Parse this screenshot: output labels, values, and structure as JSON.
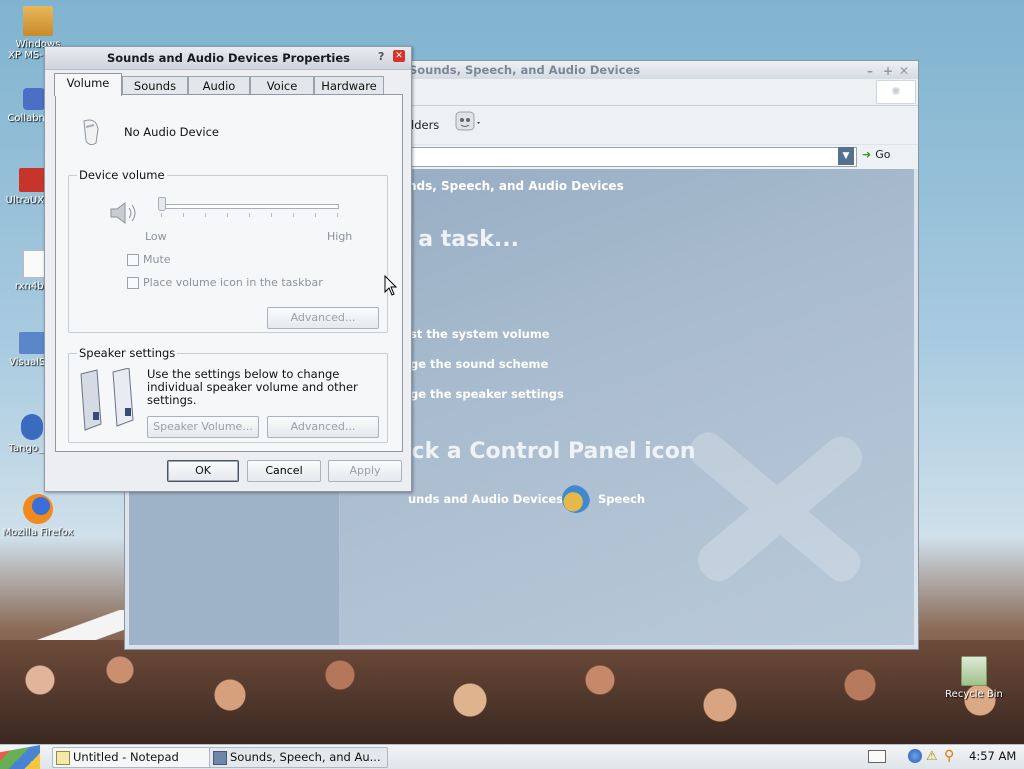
{
  "desktop": {
    "icons": [
      {
        "label": "Windows XP MS-Sig..."
      },
      {
        "label": "Collabne..."
      },
      {
        "label": "UltraUXT..."
      },
      {
        "label": "rxn4b..."
      },
      {
        "label": "VisualS..."
      },
      {
        "label": "Tango_I..."
      },
      {
        "label": "Mozilla Firefox"
      },
      {
        "label": "Recycle Bin"
      }
    ]
  },
  "control_panel": {
    "title": "Sounds, Speech, and Audio Devices",
    "toolbar_folders": "lders",
    "go_label": "Go",
    "crumb": "nds, Speech, and Audio Devices",
    "pick_task": "k a task...",
    "tasks": [
      "st the system volume",
      "ge the sound scheme",
      "ge the speaker settings"
    ],
    "pick_icon": "ick a Control Panel icon",
    "icon1": "unds and Audio Devices",
    "icon2": "Speech"
  },
  "dialog": {
    "title": "Sounds and Audio Devices Properties",
    "help": "?",
    "tabs": [
      "Volume",
      "Sounds",
      "Audio",
      "Voice",
      "Hardware"
    ],
    "device_name": "No Audio Device",
    "device_volume_label": "Device volume",
    "low": "Low",
    "high": "High",
    "mute": "Mute",
    "place_icon": "Place volume icon in the taskbar",
    "advanced1": "Advanced...",
    "speaker_settings_label": "Speaker settings",
    "speaker_text": "Use the settings below to change individual speaker volume and other settings.",
    "speaker_volume_btn": "Speaker Volume...",
    "advanced2": "Advanced...",
    "ok": "OK",
    "cancel": "Cancel",
    "apply": "Apply"
  },
  "taskbar": {
    "items": [
      "Untitled - Notepad",
      "Sounds, Speech, and Au..."
    ],
    "clock": "4:57 AM"
  }
}
